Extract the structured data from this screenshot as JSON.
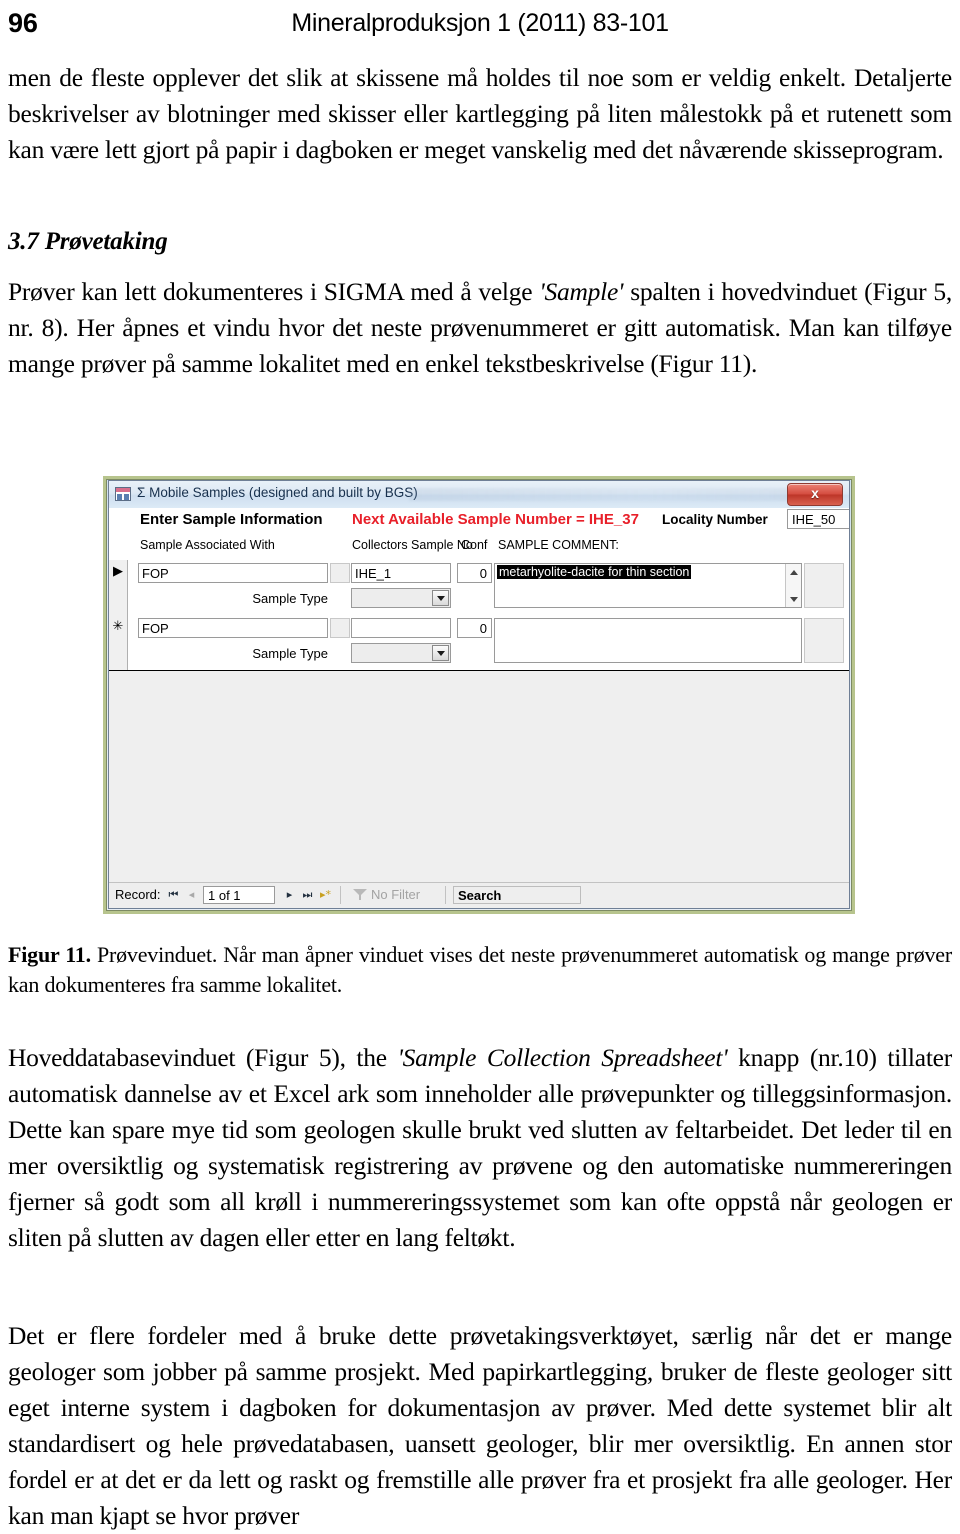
{
  "runninghead": {
    "folio": "96",
    "journal": "Mineralproduksjon 1 (2011) 83-101"
  },
  "paragraphs": {
    "p1": "men de fleste opplever det slik at skissene må holdes til noe som er veldig enkelt. Detaljerte beskrivelser av blotninger med skisser eller kartlegging på liten målestokk på et rutenett som kan være lett gjort på papir i dagboken er meget vanskelig med det nåværende skisseprogram.",
    "section_heading": "3.7 Prøvetaking",
    "p2_a": "Prøver kan lett dokumenteres i SIGMA med å velge ",
    "p2_em": "'Sample'",
    "p2_b": " spalten i hovedvinduet (Figur 5, nr. 8). Her åpnes et vindu hvor det neste prøvenummeret er gitt automatisk. Man kan tilføye mange prøver på samme lokalitet med en enkel tekstbeskrivelse (Figur 11).",
    "caption_label": "Figur 11.",
    "caption_text": " Prøvevinduet. Når man åpner vinduet vises det neste prøvenummeret automatisk og mange prøver kan dokumenteres fra samme lokalitet.",
    "p3_a": "Hoveddatabasevinduet (Figur 5), the ",
    "p3_em": "'Sample Collection Spreadsheet'",
    "p3_b": " knapp (nr.10) tillater automatisk dannelse av et Excel ark som inneholder alle prøvepunkter og tilleggsinformasjon. Dette kan spare mye tid som geologen skulle brukt ved slutten av feltarbeidet. Det leder til en mer oversiktlig og systematisk registrering av prøvene og den automatiske nummereringen fjerner så godt som all krøll i nummereringssystemet som kan ofte oppstå når geologen er sliten på slutten av dagen eller etter en lang feltøkt.",
    "p4": "Det er flere fordeler med å bruke dette prøvetakingsverktøyet, særlig når det er mange geologer som jobber på samme prosjekt. Med papirkartlegging, bruker de fleste geologer sitt eget interne system i dagboken for dokumentasjon av prøver. Med dette systemet blir alt standardisert og hele prøvedatabasen, uansett geologer, blir mer oversiktlig. En annen stor fordel er at det er da lett og raskt og fremstille alle prøver fra et prosjekt fra alle geologer. Her kan man kjapt se hvor prøver"
  },
  "figure": {
    "window": {
      "title": "Σ Mobile Samples (designed and built by BGS)",
      "close_label": "x",
      "icon": "access-form-icon"
    },
    "header": {
      "enter_sample_information": "Enter Sample Information",
      "next_available": "Next Available Sample Number = IHE_37",
      "next_available_color": "#e8202a",
      "locality_label": "Locality Number",
      "locality_value": "IHE_50"
    },
    "columns": {
      "sample_associated_with": "Sample Associated With",
      "collectors_sample_no": "Collectors Sample No",
      "conf": "Conf",
      "sample_comment": "SAMPLE COMMENT:"
    },
    "sample_type_label": "Sample Type",
    "records": [
      {
        "selector": "▶",
        "selector_name": "current-record-marker",
        "associated_with": "FOP",
        "collectors_sample_no": "IHE_1",
        "conf": "0",
        "comment": "metarhyolite-dacite for thin section",
        "comment_selected": true,
        "sample_type": ""
      },
      {
        "selector": "✳",
        "selector_name": "new-record-marker",
        "associated_with": "FOP",
        "collectors_sample_no": "",
        "conf": "0",
        "comment": "",
        "comment_selected": false,
        "sample_type": ""
      }
    ],
    "navbar": {
      "record_label": "Record:",
      "first": "⏮",
      "prev": "◂",
      "position": "1 of 1",
      "next": "▸",
      "last": "⏭",
      "new": "▸*",
      "filter_label": "No Filter",
      "search_label": "Search"
    }
  }
}
